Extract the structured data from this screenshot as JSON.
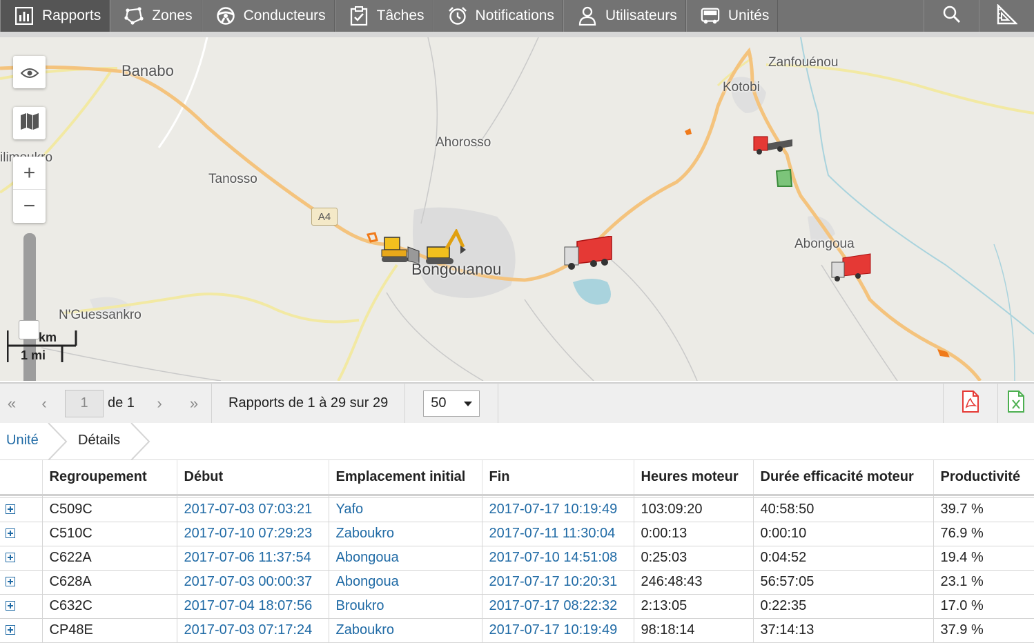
{
  "nav": {
    "items": [
      {
        "label": "Rapports",
        "icon": "report-chart-icon",
        "active": true
      },
      {
        "label": "Zones",
        "icon": "zones-polygon-icon",
        "active": false
      },
      {
        "label": "Conducteurs",
        "icon": "steering-wheel-icon",
        "active": false
      },
      {
        "label": "Tâches",
        "icon": "clipboard-check-icon",
        "active": false
      },
      {
        "label": "Notifications",
        "icon": "alarm-clock-icon",
        "active": false
      },
      {
        "label": "Utilisateurs",
        "icon": "user-icon",
        "active": false
      },
      {
        "label": "Unités",
        "icon": "bus-icon",
        "active": false
      }
    ],
    "tools": [
      "search-icon",
      "ruler-triangle-icon"
    ]
  },
  "map": {
    "places": {
      "banabo": "Banabo",
      "zanfouenou": "Zanfouénou",
      "kotobi": "Kotobi",
      "ahorosso": "Ahorosso",
      "tanosso": "Tanosso",
      "ilimoukro": "ilimoukro",
      "bongouanou": "Bongouanou",
      "abongoua": "Abongoua",
      "nguessankro": "N'Guessankro"
    },
    "road_label": "A4",
    "controls": {
      "zoom_in": "+",
      "zoom_out": "−"
    },
    "scale": {
      "km": "km",
      "mi": "1 mi"
    }
  },
  "pager": {
    "page": "1",
    "of_label": "de 1",
    "summary": "Rapports de 1 à 29 sur 29",
    "page_size": "50"
  },
  "breadcrumb": {
    "unit": "Unité",
    "details": "Détails"
  },
  "table": {
    "headers": [
      "Regroupement",
      "Début",
      "Emplacement initial",
      "Fin",
      "Heures moteur",
      "Durée efficacité moteur",
      "Productivité"
    ],
    "rows": [
      [
        "C509C",
        "2017-07-03 07:03:21",
        "Yafo",
        "2017-07-17 10:19:49",
        "103:09:20",
        "40:58:50",
        "39.7 %"
      ],
      [
        "C510C",
        "2017-07-10 07:29:23",
        "Zaboukro",
        "2017-07-11 11:30:04",
        "0:00:13",
        "0:00:10",
        "76.9 %"
      ],
      [
        "C622A",
        "2017-07-06 11:37:54",
        "Abongoua",
        "2017-07-10 14:51:08",
        "0:25:03",
        "0:04:52",
        "19.4 %"
      ],
      [
        "C628A",
        "2017-07-03 00:00:37",
        "Abongoua",
        "2017-07-17 10:20:31",
        "246:48:43",
        "56:57:05",
        "23.1 %"
      ],
      [
        "C632C",
        "2017-07-04 18:07:56",
        "Broukro",
        "2017-07-17 08:22:32",
        "2:13:05",
        "0:22:35",
        "17.0 %"
      ],
      [
        "CP48E",
        "2017-07-03 07:17:24",
        "Zaboukro",
        "2017-07-17 10:19:49",
        "98:18:14",
        "37:14:13",
        "37.9 %"
      ]
    ]
  },
  "colors": {
    "link": "#1f6aa5",
    "nav_bg": "#737373",
    "nav_active": "#555555",
    "pdf": "#e53935",
    "excel": "#4caf50"
  }
}
